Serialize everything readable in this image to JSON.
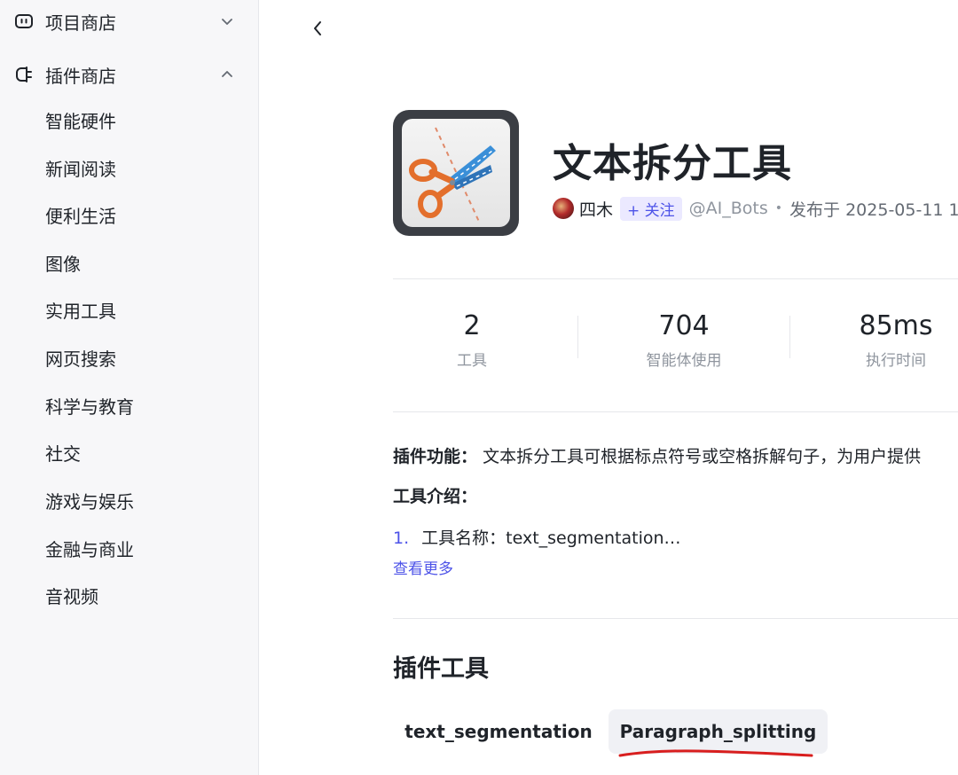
{
  "sidebar": {
    "groups": [
      {
        "label": "项目商店",
        "icon": "robot-icon",
        "expanded": false
      },
      {
        "label": "插件商店",
        "icon": "plug-icon",
        "expanded": true
      }
    ],
    "items": [
      {
        "label": "智能硬件"
      },
      {
        "label": "新闻阅读"
      },
      {
        "label": "便利生活"
      },
      {
        "label": "图像"
      },
      {
        "label": "实用工具"
      },
      {
        "label": "网页搜索"
      },
      {
        "label": "科学与教育"
      },
      {
        "label": "社交"
      },
      {
        "label": "游戏与娱乐"
      },
      {
        "label": "金融与商业"
      },
      {
        "label": "音视频"
      }
    ]
  },
  "header": {
    "back_icon": "chevron-left-icon",
    "plugin_icon": "scissors-icon",
    "title": "文本拆分工具",
    "author": "四木",
    "follow_label": "+ 关注",
    "handle": "@AI_Bots",
    "dot": "•",
    "published": "发布于 2025-05-11 1"
  },
  "stats": [
    {
      "value": "2",
      "label": "工具"
    },
    {
      "value": "704",
      "label": "智能体使用"
    },
    {
      "value": "85ms",
      "label": "执行时间"
    }
  ],
  "description": {
    "func_label": "插件功能：",
    "func_text": "文本拆分工具可根据标点符号或空格拆解句子，为用户提供",
    "intro_label": "工具介绍：",
    "intro_index": "1.",
    "intro_text": "工具名称：text_segmentation…",
    "more_label": "查看更多"
  },
  "tools": {
    "section_title": "插件工具",
    "tabs": [
      {
        "label": "text_segmentation",
        "active": false
      },
      {
        "label": "Paragraph_splitting",
        "active": true
      }
    ]
  },
  "colors": {
    "accent": "#4d53e8",
    "annotation_red": "#d81e1e"
  }
}
